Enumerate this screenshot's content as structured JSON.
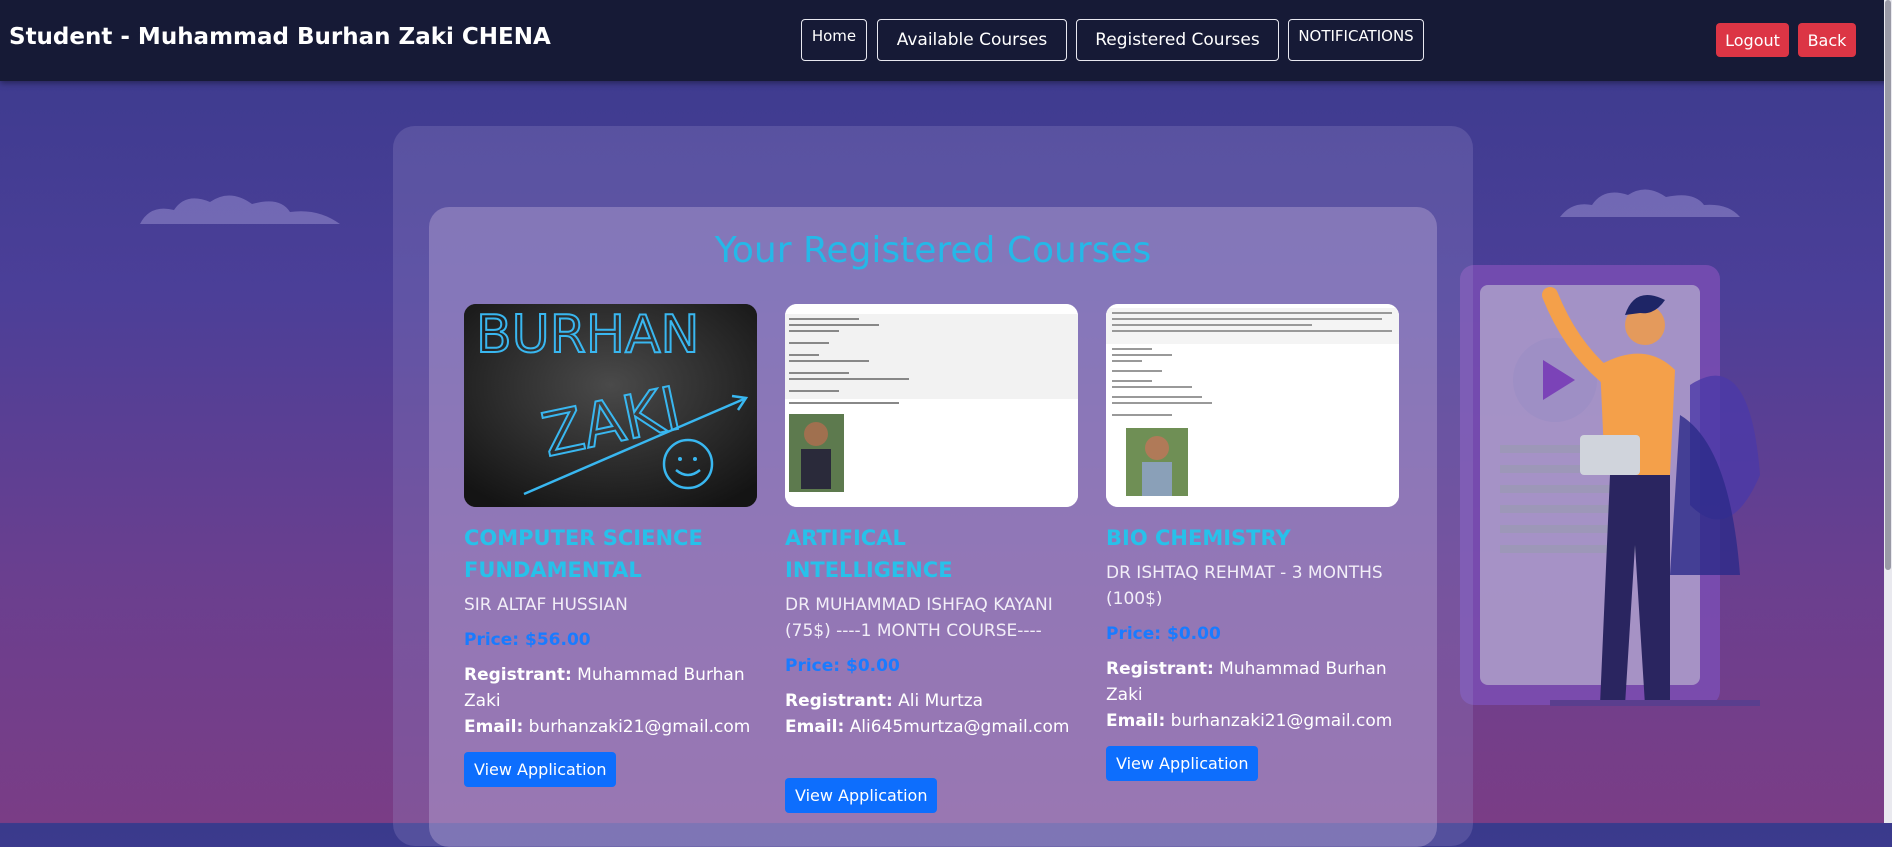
{
  "header": {
    "brand": "Student - Muhammad Burhan Zaki CHENA",
    "nav": [
      "Home",
      "Available Courses",
      "Registered Courses",
      "NOTIFICATIONS"
    ],
    "logout": "Logout",
    "back": "Back"
  },
  "main": {
    "title": "Your Registered Courses",
    "registrant_label": "Registrant:",
    "email_label": "Email:",
    "courses": [
      {
        "name": "COMPUTER SCIENCE FUNDAMENTAL",
        "instructor": "SIR ALTAF HUSSIAN",
        "price": "Price: $56.00",
        "registrant": "Muhammad Burhan Zaki",
        "email": "burhanzaki21@gmail.com",
        "button": "View Application",
        "thumb_text": [
          "BURHAN",
          "ZAKI"
        ]
      },
      {
        "name": "ARTIFICAL INTELLIGENCE",
        "instructor": "DR MUHAMMAD ISHFAQ KAYANI (75$) ----1 MONTH COURSE----",
        "price": "Price: $0.00",
        "registrant": "Ali Murtza",
        "email": "Ali645murtza@gmail.com",
        "button": "View Application"
      },
      {
        "name": "BIO CHEMISTRY",
        "instructor": "DR ISHTAQ REHMAT - 3 MONTHS (100$)",
        "price": "Price: $0.00",
        "registrant": "Muhammad Burhan Zaki",
        "email": "burhanzaki21@gmail.com",
        "button": "View Application"
      }
    ]
  },
  "colors": {
    "navbar": "#161a36",
    "danger": "#dc3545",
    "primary": "#0d6efd",
    "title": "#25b8e8"
  }
}
